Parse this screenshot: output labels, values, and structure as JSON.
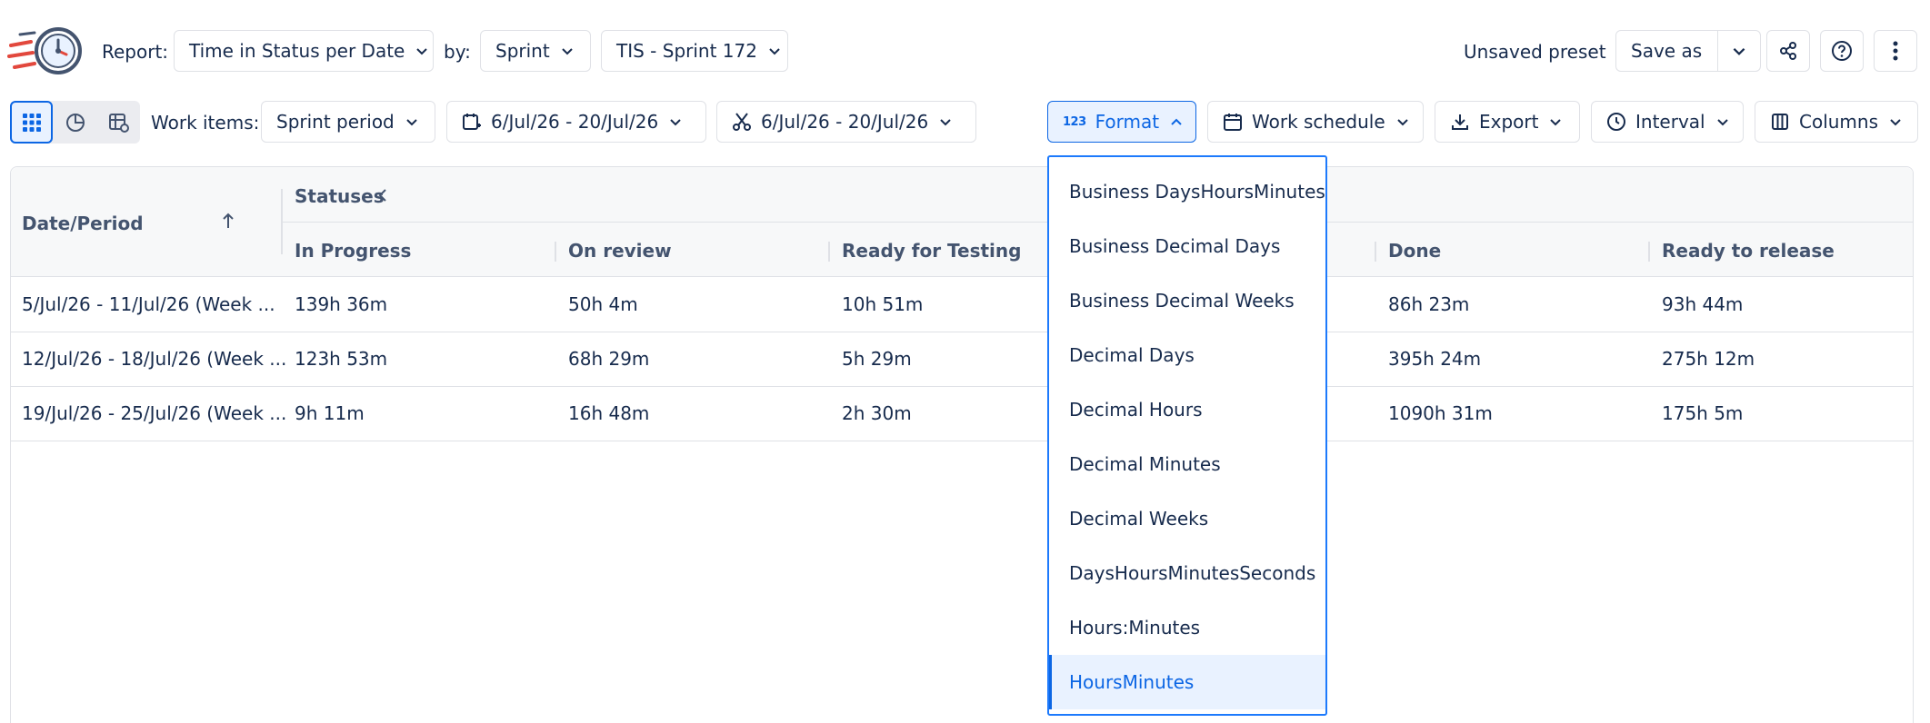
{
  "header": {
    "report_label": "Report:",
    "report_value": "Time in Status per Date",
    "by_label": "by:",
    "by_value": "Sprint",
    "sprint_value": "TIS - Sprint 172",
    "preset_status": "Unsaved preset",
    "save_as_label": "Save as"
  },
  "toolbar": {
    "work_items_label": "Work items:",
    "work_items_value": "Sprint period",
    "date_range_1": "6/Jul/26 - 20/Jul/26",
    "date_range_2": "6/Jul/26 - 20/Jul/26",
    "format_label": "Format",
    "format_icon_text": "123",
    "work_schedule_label": "Work schedule",
    "export_label": "Export",
    "interval_label": "Interval",
    "columns_label": "Columns"
  },
  "table": {
    "date_period_header": "Date/Period",
    "statuses_header": "Statuses",
    "columns": [
      "In Progress",
      "On review",
      "Ready for Testing",
      "Done",
      "Ready to release"
    ],
    "rows": [
      {
        "period": "5/Jul/26 - 11/Jul/26 (Week ...",
        "values": [
          "139h 36m",
          "50h 4m",
          "10h 51m",
          "86h 23m",
          "93h 44m"
        ]
      },
      {
        "period": "12/Jul/26 - 18/Jul/26 (Week ...",
        "values": [
          "123h 53m",
          "68h 29m",
          "5h 29m",
          "395h 24m",
          "275h 12m"
        ]
      },
      {
        "period": "19/Jul/26 - 25/Jul/26 (Week ...",
        "values": [
          "9h 11m",
          "16h 48m",
          "2h 30m",
          "1090h 31m",
          "175h 5m"
        ]
      }
    ]
  },
  "format_menu": {
    "items": [
      "Business DaysHoursMinutes",
      "Business Decimal Days",
      "Business Decimal Weeks",
      "Decimal Days",
      "Decimal Hours",
      "Decimal Minutes",
      "Decimal Weeks",
      "DaysHoursMinutesSeconds",
      "Hours:Minutes",
      "HoursMinutes"
    ],
    "selected": "HoursMinutes"
  },
  "colors": {
    "accent": "#0c66e4",
    "logo_blue": "#44546f",
    "logo_red": "#e2483d"
  },
  "icons": {
    "logo": "timer-logo-icon",
    "grid": "grid-view-icon",
    "pie": "pie-chart-icon",
    "table_settings": "table-settings-icon",
    "calendar_add": "calendar-add-icon",
    "cut": "scissors-icon",
    "calendar": "calendar-icon",
    "export": "download-icon",
    "clock": "clock-icon",
    "columns": "columns-icon",
    "share": "share-icon",
    "help": "help-icon",
    "more": "more-vertical-icon"
  }
}
